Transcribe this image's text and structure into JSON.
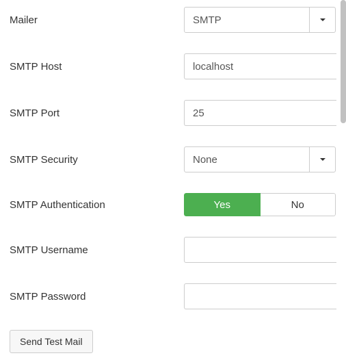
{
  "fields": {
    "mailer": {
      "label": "Mailer",
      "value": "SMTP"
    },
    "smtp_host": {
      "label": "SMTP Host",
      "value": "localhost"
    },
    "smtp_port": {
      "label": "SMTP Port",
      "value": "25"
    },
    "smtp_security": {
      "label": "SMTP Security",
      "value": "None"
    },
    "smtp_auth": {
      "label": "SMTP Authentication",
      "yes": "Yes",
      "no": "No",
      "selected": "yes"
    },
    "smtp_username": {
      "label": "SMTP Username",
      "value": ""
    },
    "smtp_password": {
      "label": "SMTP Password",
      "value": ""
    }
  },
  "actions": {
    "send_test": "Send Test Mail"
  }
}
